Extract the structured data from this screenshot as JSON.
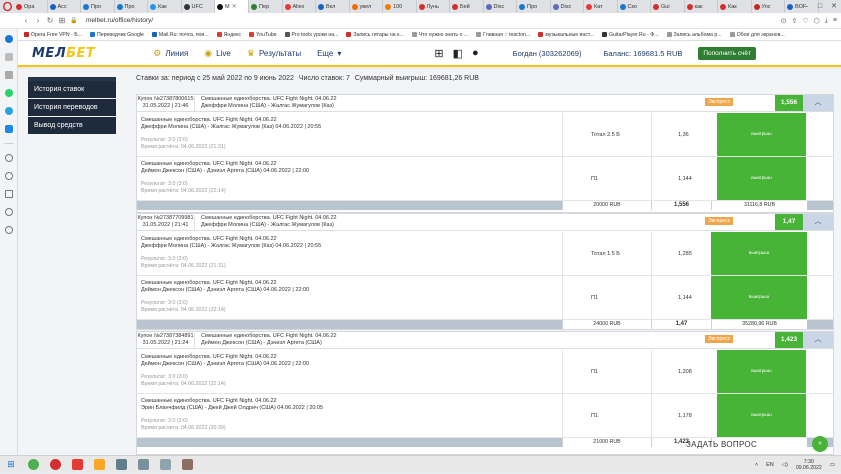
{
  "browser": {
    "tabs": [
      {
        "label": "Ора",
        "color": "#d32f2f"
      },
      {
        "label": "Асс",
        "color": "#1565c0"
      },
      {
        "label": "Про",
        "color": "#1976d2"
      },
      {
        "label": "Про",
        "color": "#1976d2"
      },
      {
        "label": "Как",
        "color": "#2196f3"
      },
      {
        "label": "UFC",
        "color": "#333333"
      },
      {
        "label": "М",
        "color": "#111111",
        "active": true
      },
      {
        "label": "Пер",
        "color": "#2e7d32"
      },
      {
        "label": "Aliex",
        "color": "#e53935"
      },
      {
        "label": "Вкл",
        "color": "#1565c0"
      },
      {
        "label": "увел",
        "color": "#ef6c00"
      },
      {
        "label": "100",
        "color": "#f57c00"
      },
      {
        "label": "Лунь",
        "color": "#d32f2f"
      },
      {
        "label": "Бей",
        "color": "#d32f2f"
      },
      {
        "label": "Disc",
        "color": "#5c6bc0"
      },
      {
        "label": "Про",
        "color": "#1976d2"
      },
      {
        "label": "Disc",
        "color": "#5c6bc0"
      },
      {
        "label": "Кат",
        "color": "#e53935"
      },
      {
        "label": "Ско",
        "color": "#1976d2"
      },
      {
        "label": "Gui",
        "color": "#d32f2f"
      },
      {
        "label": "как",
        "color": "#d32f2f"
      },
      {
        "label": "Как",
        "color": "#d32f2f"
      },
      {
        "label": "Упс",
        "color": "#c62828"
      },
      {
        "label": "BOF",
        "color": "#1565c0"
      }
    ],
    "url": "melbet.ru/office/history/",
    "bookmarks": [
      {
        "label": "Opera Free VPN - Б...",
        "color": "#c62828"
      },
      {
        "label": "Переводчик Google",
        "color": "#1976d2"
      },
      {
        "label": "Mail.Ru: почта, пои...",
        "color": "#1565c0"
      },
      {
        "label": "Яндекс",
        "color": "#e53935"
      },
      {
        "label": "YouTube",
        "color": "#e53935"
      },
      {
        "label": "Pro tools уроки на...",
        "color": "#555555"
      },
      {
        "label": "Запись гитары на к...",
        "color": "#d32f2f"
      },
      {
        "label": "Что нужно знать о ...",
        "color": "#999999"
      },
      {
        "label": "Главная :: reacton...",
        "color": "#999999"
      },
      {
        "label": "музыкальные инст...",
        "color": "#d32f2f"
      },
      {
        "label": "GuitarPlayer.Ru - Ф...",
        "color": "#333333"
      },
      {
        "label": "Запись альбома р...",
        "color": "#999999"
      },
      {
        "label": "Обои для экранов...",
        "color": "#999999"
      }
    ]
  },
  "site": {
    "logo_main": "МЕЛ",
    "logo_accent": "БЕТ",
    "nav": [
      {
        "label": "Линия",
        "icon": "handshake-icon",
        "glyph": "⚙"
      },
      {
        "label": "Live",
        "icon": "live-icon",
        "glyph": "◉"
      },
      {
        "label": "Результаты",
        "icon": "trophy-icon",
        "glyph": "♛"
      },
      {
        "label": "Еще",
        "icon": "chevron-down-icon",
        "glyph": "▾"
      }
    ],
    "user": "Богдан (303262069)",
    "balance": "Баланс: 169681.5 RUB",
    "deposit_button": "Пополнить счёт"
  },
  "menu": [
    {
      "label": "История ставок"
    },
    {
      "label": "История переводов"
    },
    {
      "label": "Вывод средств"
    }
  ],
  "filter": {
    "period": "Ставки за: период с 25 май 2022 по 9 июнь 2022",
    "count": "Число ставок: 7",
    "total": "Суммарный выигрыш: 169681,26 RUB"
  },
  "coupons": [
    {
      "id": "Купон №27387800615",
      "date": "31.05.2022 | 21:46",
      "title": "Смешанные единоборства. UFC Fight Night. 04.06.22",
      "subtitle": "Джеффри Молина (США) - Жалгас Жумагулов (Каз)",
      "type": "Экспресс",
      "odds": "1,556",
      "rows": [
        {
          "event": "Смешанные единоборства. UFC Fight Night. 04.06.22",
          "match": "Джеффри Молина (США) - Жалгас Жумагулов (Каз) 04.06.2022 | 20:55",
          "score": "Результат: 3:0 (3:0)",
          "settled": "Время расчёта: 04.06.2022 (21:31)",
          "bet": "Тотал 2.5 Б",
          "odd": "1,36",
          "outcome": "выигрыш"
        },
        {
          "event": "Смешанные единоборства. UFC Fight Night. 04.06.22",
          "match": "Деймон Джексон (США) - Дэниэл Аргета (США) 04.06.2022 | 22:00",
          "score": "Результат: 3:0 (3:0)",
          "settled": "Время расчёта: 04.06.2022 (22:14)",
          "bet": "П1",
          "odd": "1,144",
          "outcome": "выигрыш"
        }
      ],
      "stake": "20000 RUB",
      "total_odds": "1,556",
      "payout": "31116,8 RUB"
    },
    {
      "id": "Купон №27387709981",
      "date": "31.05.2022 | 21:41",
      "title": "Смешанные единоборства. UFC Fight Night. 04.06.22",
      "subtitle": "Джеффри Молина (США) - Жалгас Жумагулов (Каз)",
      "type": "Экспресс",
      "odds": "1,47",
      "rows": [
        {
          "event": "Смешанные единоборства. UFC Fight Night. 04.06.22",
          "match": "Джеффри Молина (США) - Жалгас Жумагулов (Каз) 04.06.2022 | 20:55",
          "score": "Результат: 3:0 (3:0)",
          "settled": "Время расчёта: 04.06.2022 (21:31)",
          "bet": "Тотал 1.5 Б",
          "odd": "1,285",
          "outcome": "выигрыш"
        },
        {
          "event": "Смешанные единоборства. UFC Fight Night. 04.06.22",
          "match": "Деймон Джексон (США) - Дэниэл Аргета (США) 04.06.2022 | 22:00",
          "score": "Результат: 3:0 (3:0)",
          "settled": "Время расчёта: 04.06.2022 (22:14)",
          "bet": "П1",
          "odd": "1,144",
          "outcome": "выигрыш"
        }
      ],
      "stake": "24000 RUB",
      "total_odds": "1,47",
      "payout": "35280,96 RUB"
    },
    {
      "id": "Купон №27387384891",
      "date": "31.05.2022 | 21:24",
      "title": "Смешанные единоборства. UFC Fight Night. 04.06.22",
      "subtitle": "Деймон Джексон (США) - Дэниэл Аргета (США)",
      "type": "Экспресс",
      "odds": "1,423",
      "rows": [
        {
          "event": "Смешанные единоборства. UFC Fight Night. 04.06.22",
          "match": "Деймон Джексон (США) - Дэниэл Аргета (США) 04.06.2022 | 22:00",
          "score": "Результат: 3:0 (3:0)",
          "settled": "Время расчёта: 04.06.2022 (22:14)",
          "bet": "П1",
          "odd": "1,208",
          "outcome": "выигрыш"
        },
        {
          "event": "Смешанные единоборства. UFC Fight Night. 04.06.22",
          "match": "Эрин Бланчфилд (США) - Джей Джей Олдрич (США) 04.06.2022 | 20:05",
          "score": "Результат: 2:0 (2:0)",
          "settled": "Время расчёта: 04.06.2022 (20:30)",
          "bet": "П1",
          "odd": "1,178",
          "outcome": "выигрыш"
        }
      ],
      "stake": "21000 RUB",
      "total_odds": "1,423",
      "payout": ""
    }
  ],
  "ask_question": "ЗАДАТЬ ВОПРОС",
  "taskbar": {
    "apps": [
      {
        "name": "chrome",
        "color": "#4caf50"
      },
      {
        "name": "opera",
        "color": "#d32f2f"
      },
      {
        "name": "media",
        "color": "#e53935"
      },
      {
        "name": "folder",
        "color": "#f9a825"
      },
      {
        "name": "files",
        "color": "#607d8b"
      },
      {
        "name": "terminal",
        "color": "#78909c"
      },
      {
        "name": "screen",
        "color": "#90a4ae"
      },
      {
        "name": "cart",
        "color": "#8d6e63"
      }
    ],
    "lang": "EN",
    "time": "7:30",
    "date": "09.06.2022"
  },
  "colors": {
    "brand_navy": "#1d3b69",
    "brand_yellow": "#f5c518",
    "win_green": "#47b337",
    "express_orange": "#f0a54a"
  }
}
